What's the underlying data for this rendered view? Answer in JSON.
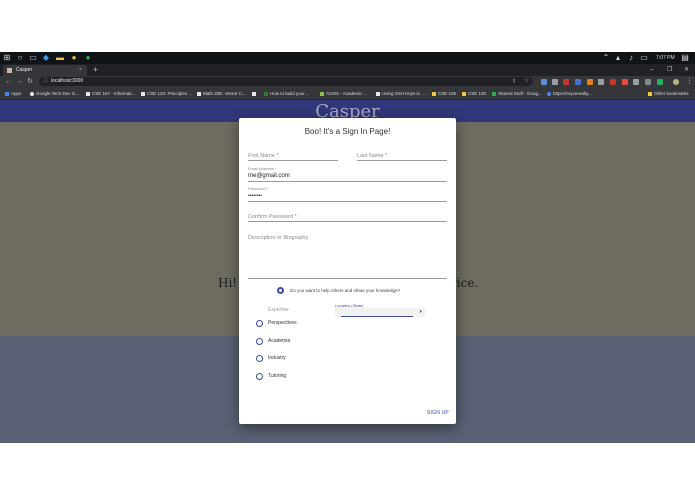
{
  "taskbar": {
    "time": "7:07 PM"
  },
  "browser": {
    "tab_title": "Casper",
    "tab_close": "×",
    "new_tab": "+",
    "url": "localhost:3000",
    "back": "←",
    "forward": "→",
    "reload": "↻",
    "minimize": "–",
    "maximize": "❐",
    "close": "✕",
    "star": "☆"
  },
  "bookmarks": {
    "items": [
      {
        "label": "Apps",
        "color": "#4285f4"
      },
      {
        "label": "Google Tech Dev G...",
        "color": "#e8e8e8"
      },
      {
        "label": "CSE 167 - Informati...",
        "color": "#e8e8e8"
      },
      {
        "label": "CSE 120: Principles ...",
        "color": "#e8e8e8"
      },
      {
        "label": "Math 20E: Vector C...",
        "color": "#e8e8e8"
      },
      {
        "label": "",
        "color": "#e8e8e8"
      },
      {
        "label": "How to build your ...",
        "color": "#2e7d32"
      },
      {
        "label": "ACMS - Academic ...",
        "color": "#8bc34a"
      },
      {
        "label": "Using SSH Keys in ...",
        "color": "#e8e8e8"
      },
      {
        "label": "CSE 105",
        "color": "#f4c542"
      },
      {
        "label": "CSE 100",
        "color": "#f4c542"
      },
      {
        "label": "Shared Stuff - Goog...",
        "color": "#34a853"
      },
      {
        "label": "https://roycerealty...",
        "color": "#4285f4"
      }
    ],
    "other": "Other bookmarks"
  },
  "page": {
    "brand": "Casper",
    "hero_left": "Hi! I",
    "hero_right": "vice."
  },
  "dialog": {
    "title": "Boo! It's a Sign In Page!",
    "first_name_placeholder": "First Name *",
    "last_name_placeholder": "Last Name *",
    "email_label": "Email Address *",
    "email_value": "me@gmail.com",
    "password_label": "Password *",
    "password_value": "••••••••",
    "confirm_password_placeholder": "Confirm Password *",
    "bio_placeholder": "Description or Biography",
    "help_question": "Do you want to help others and share your knowledge?",
    "expertise_label": "Expertise",
    "location_label": "Location (State)",
    "location_arrow": "▾",
    "expertise_options": [
      "Perspectives",
      "Academia",
      "Industry",
      "Tutoring"
    ],
    "sign_up": "SIGN UP"
  }
}
